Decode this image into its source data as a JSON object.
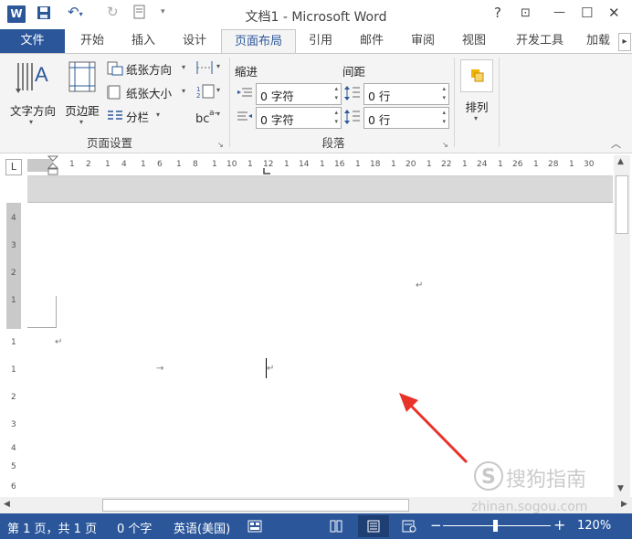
{
  "titlebar": {
    "logo": "W",
    "title": "文档1 - Microsoft Word",
    "help": "?",
    "restore_ribbon": "⊡",
    "minimize": "—",
    "maximize": "☐",
    "close": "✕"
  },
  "tabs": {
    "file": "文件",
    "items": [
      "开始",
      "插入",
      "设计",
      "页面布局",
      "引用",
      "邮件",
      "审阅",
      "视图",
      "开发工具",
      "加载"
    ],
    "active": "页面布局"
  },
  "ribbon": {
    "page_setup": {
      "text_direction": "文字方向",
      "margins": "页边距",
      "orientation": "纸张方向",
      "size": "纸张大小",
      "columns": "分栏",
      "group_label": "页面设置"
    },
    "paragraph": {
      "indent_label": "缩进",
      "spacing_label": "间距",
      "indent_left": "0 字符",
      "indent_right": "0 字符",
      "spacing_before": "0 行",
      "spacing_after": "0 行",
      "group_label": "段落"
    },
    "arrange": {
      "label": "排列"
    }
  },
  "ruler": {
    "h_labels": [
      "L",
      "1",
      "2",
      "1",
      "4",
      "1",
      "6",
      "1",
      "8",
      "1",
      "10",
      "1",
      "12",
      "1",
      "14",
      "1",
      "16",
      "1",
      "18",
      "1",
      "20",
      "1",
      "22",
      "1",
      "24",
      "1",
      "26",
      "1",
      "28",
      "1",
      "30"
    ],
    "v_labels": [
      "4",
      "3",
      "2",
      "1",
      "1",
      "1",
      "2",
      "3",
      "4",
      "5",
      "6"
    ]
  },
  "statusbar": {
    "page": "第 1 页，共 1 页",
    "words": "0 个字",
    "language": "英语(美国)",
    "zoom_minus": "−",
    "zoom_plus": "+",
    "zoom": "120%",
    "zoom_level": 0.48
  },
  "watermark": {
    "brand": "搜狗指南",
    "url": "zhinan.sogou.com"
  },
  "colors": {
    "accent": "#2b579a",
    "arrow": "#e8332b"
  }
}
